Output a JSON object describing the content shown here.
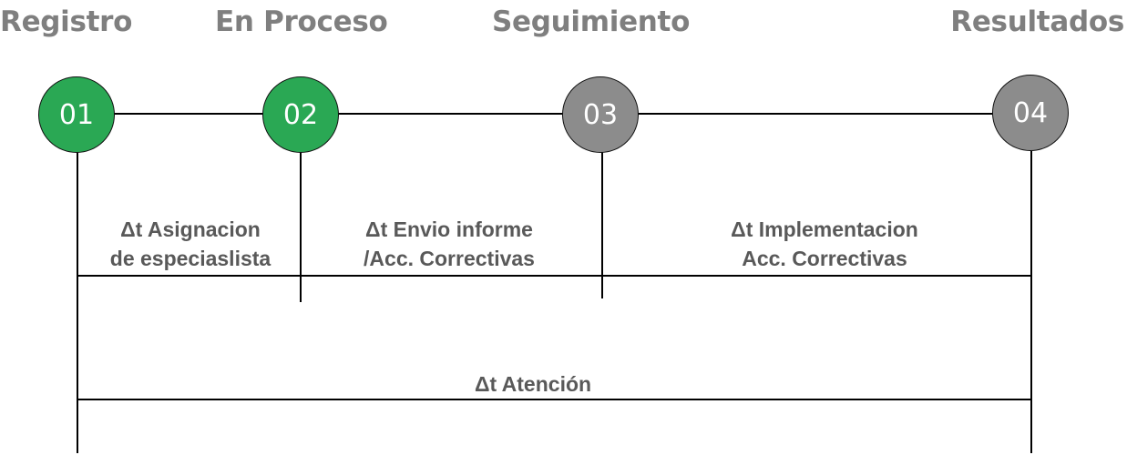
{
  "stages": [
    {
      "title": "Registro",
      "number": "01",
      "color": "#2aa854"
    },
    {
      "title": "En Proceso",
      "number": "02",
      "color": "#2aa854"
    },
    {
      "title": "Seguimiento",
      "number": "03",
      "color": "#8c8c8c"
    },
    {
      "title": "Resultados",
      "number": "04",
      "color": "#8c8c8c"
    }
  ],
  "intervals": [
    {
      "line1": "Δt Asignacion",
      "line2": "de especiaslista"
    },
    {
      "line1": "Δt Envio informe",
      "line2": "/Acc. Correctivas"
    },
    {
      "line1": "Δt Implementacion",
      "line2": "Acc. Correctivas"
    }
  ],
  "total_interval": "Δt Atención",
  "colors": {
    "completed": "#2aa854",
    "pending": "#8c8c8c",
    "title_text": "#7f7f7f",
    "label_text": "#595959",
    "lines": "#000000"
  }
}
